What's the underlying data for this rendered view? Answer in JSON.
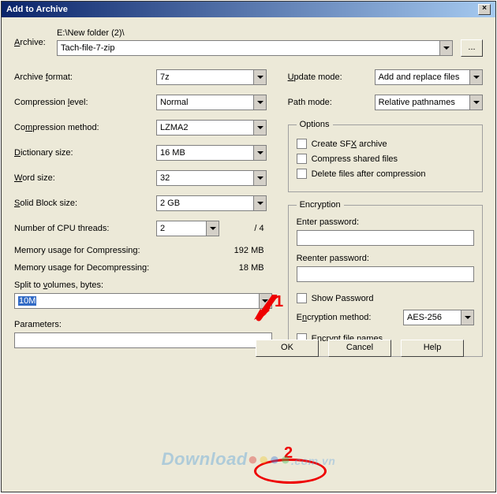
{
  "title": "Add to Archive",
  "archive": {
    "label": "Archive:",
    "path": "E:\\New folder (2)\\",
    "filename": "Tach-file-7-zip",
    "browse": "..."
  },
  "left": {
    "format": {
      "label": "Archive format:",
      "value": "7z",
      "u": "f"
    },
    "level": {
      "label": "Compression level:",
      "value": "Normal",
      "u": "l"
    },
    "method": {
      "label": "Compression method:",
      "value": "LZMA2",
      "u": "m"
    },
    "dict": {
      "label": "Dictionary size:",
      "value": "16 MB",
      "u": "D"
    },
    "word": {
      "label": "Word size:",
      "value": "32",
      "u": "W"
    },
    "block": {
      "label": "Solid Block size:",
      "value": "2 GB",
      "u": "S"
    },
    "threads": {
      "label": "Number of CPU threads:",
      "value": "2",
      "max": "/ 4"
    },
    "mem_comp": {
      "label": "Memory usage for Compressing:",
      "value": "192 MB"
    },
    "mem_decomp": {
      "label": "Memory usage for Decompressing:",
      "value": "18 MB"
    },
    "split": {
      "label": "Split to volumes, bytes:",
      "value": "10M",
      "u": "v"
    },
    "params": {
      "label": "Parameters:",
      "value": ""
    }
  },
  "right": {
    "update": {
      "label": "Update mode:",
      "value": "Add and replace files",
      "u": "U"
    },
    "pathmode": {
      "label": "Path mode:",
      "value": "Relative pathnames"
    },
    "options": {
      "legend": "Options",
      "sfx": "Create SFX archive",
      "shared": "Compress shared files",
      "delete": "Delete files after compression"
    },
    "encryption": {
      "legend": "Encryption",
      "enter": "Enter password:",
      "reenter": "Reenter password:",
      "show": "Show Password",
      "method_label": "Encryption method:",
      "method_value": "AES-256",
      "encrypt_names": "Encrypt file names",
      "u_method": "n",
      "u_names": "y"
    }
  },
  "buttons": {
    "ok": "OK",
    "cancel": "Cancel",
    "help": "Help"
  },
  "annotations": {
    "one": "1",
    "two": "2"
  },
  "watermark": {
    "text": "Download",
    "suffix": ".com.vn"
  }
}
